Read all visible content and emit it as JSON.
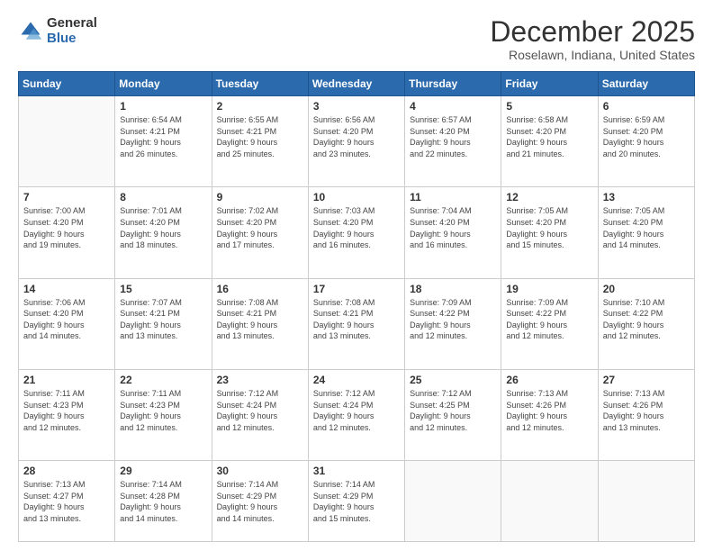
{
  "logo": {
    "general": "General",
    "blue": "Blue"
  },
  "header": {
    "month": "December 2025",
    "location": "Roselawn, Indiana, United States"
  },
  "weekdays": [
    "Sunday",
    "Monday",
    "Tuesday",
    "Wednesday",
    "Thursday",
    "Friday",
    "Saturday"
  ],
  "weeks": [
    [
      {
        "day": "",
        "info": ""
      },
      {
        "day": "1",
        "info": "Sunrise: 6:54 AM\nSunset: 4:21 PM\nDaylight: 9 hours\nand 26 minutes."
      },
      {
        "day": "2",
        "info": "Sunrise: 6:55 AM\nSunset: 4:21 PM\nDaylight: 9 hours\nand 25 minutes."
      },
      {
        "day": "3",
        "info": "Sunrise: 6:56 AM\nSunset: 4:20 PM\nDaylight: 9 hours\nand 23 minutes."
      },
      {
        "day": "4",
        "info": "Sunrise: 6:57 AM\nSunset: 4:20 PM\nDaylight: 9 hours\nand 22 minutes."
      },
      {
        "day": "5",
        "info": "Sunrise: 6:58 AM\nSunset: 4:20 PM\nDaylight: 9 hours\nand 21 minutes."
      },
      {
        "day": "6",
        "info": "Sunrise: 6:59 AM\nSunset: 4:20 PM\nDaylight: 9 hours\nand 20 minutes."
      }
    ],
    [
      {
        "day": "7",
        "info": "Sunrise: 7:00 AM\nSunset: 4:20 PM\nDaylight: 9 hours\nand 19 minutes."
      },
      {
        "day": "8",
        "info": "Sunrise: 7:01 AM\nSunset: 4:20 PM\nDaylight: 9 hours\nand 18 minutes."
      },
      {
        "day": "9",
        "info": "Sunrise: 7:02 AM\nSunset: 4:20 PM\nDaylight: 9 hours\nand 17 minutes."
      },
      {
        "day": "10",
        "info": "Sunrise: 7:03 AM\nSunset: 4:20 PM\nDaylight: 9 hours\nand 16 minutes."
      },
      {
        "day": "11",
        "info": "Sunrise: 7:04 AM\nSunset: 4:20 PM\nDaylight: 9 hours\nand 16 minutes."
      },
      {
        "day": "12",
        "info": "Sunrise: 7:05 AM\nSunset: 4:20 PM\nDaylight: 9 hours\nand 15 minutes."
      },
      {
        "day": "13",
        "info": "Sunrise: 7:05 AM\nSunset: 4:20 PM\nDaylight: 9 hours\nand 14 minutes."
      }
    ],
    [
      {
        "day": "14",
        "info": "Sunrise: 7:06 AM\nSunset: 4:20 PM\nDaylight: 9 hours\nand 14 minutes."
      },
      {
        "day": "15",
        "info": "Sunrise: 7:07 AM\nSunset: 4:21 PM\nDaylight: 9 hours\nand 13 minutes."
      },
      {
        "day": "16",
        "info": "Sunrise: 7:08 AM\nSunset: 4:21 PM\nDaylight: 9 hours\nand 13 minutes."
      },
      {
        "day": "17",
        "info": "Sunrise: 7:08 AM\nSunset: 4:21 PM\nDaylight: 9 hours\nand 13 minutes."
      },
      {
        "day": "18",
        "info": "Sunrise: 7:09 AM\nSunset: 4:22 PM\nDaylight: 9 hours\nand 12 minutes."
      },
      {
        "day": "19",
        "info": "Sunrise: 7:09 AM\nSunset: 4:22 PM\nDaylight: 9 hours\nand 12 minutes."
      },
      {
        "day": "20",
        "info": "Sunrise: 7:10 AM\nSunset: 4:22 PM\nDaylight: 9 hours\nand 12 minutes."
      }
    ],
    [
      {
        "day": "21",
        "info": "Sunrise: 7:11 AM\nSunset: 4:23 PM\nDaylight: 9 hours\nand 12 minutes."
      },
      {
        "day": "22",
        "info": "Sunrise: 7:11 AM\nSunset: 4:23 PM\nDaylight: 9 hours\nand 12 minutes."
      },
      {
        "day": "23",
        "info": "Sunrise: 7:12 AM\nSunset: 4:24 PM\nDaylight: 9 hours\nand 12 minutes."
      },
      {
        "day": "24",
        "info": "Sunrise: 7:12 AM\nSunset: 4:24 PM\nDaylight: 9 hours\nand 12 minutes."
      },
      {
        "day": "25",
        "info": "Sunrise: 7:12 AM\nSunset: 4:25 PM\nDaylight: 9 hours\nand 12 minutes."
      },
      {
        "day": "26",
        "info": "Sunrise: 7:13 AM\nSunset: 4:26 PM\nDaylight: 9 hours\nand 12 minutes."
      },
      {
        "day": "27",
        "info": "Sunrise: 7:13 AM\nSunset: 4:26 PM\nDaylight: 9 hours\nand 13 minutes."
      }
    ],
    [
      {
        "day": "28",
        "info": "Sunrise: 7:13 AM\nSunset: 4:27 PM\nDaylight: 9 hours\nand 13 minutes."
      },
      {
        "day": "29",
        "info": "Sunrise: 7:14 AM\nSunset: 4:28 PM\nDaylight: 9 hours\nand 14 minutes."
      },
      {
        "day": "30",
        "info": "Sunrise: 7:14 AM\nSunset: 4:29 PM\nDaylight: 9 hours\nand 14 minutes."
      },
      {
        "day": "31",
        "info": "Sunrise: 7:14 AM\nSunset: 4:29 PM\nDaylight: 9 hours\nand 15 minutes."
      },
      {
        "day": "",
        "info": ""
      },
      {
        "day": "",
        "info": ""
      },
      {
        "day": "",
        "info": ""
      }
    ]
  ]
}
